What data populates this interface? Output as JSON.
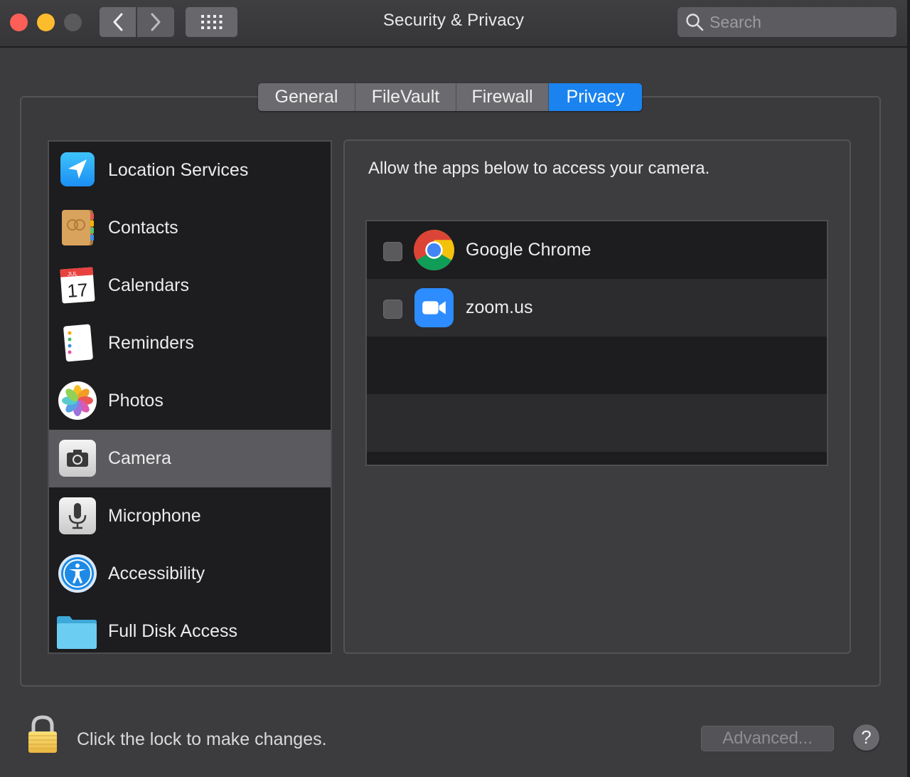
{
  "window": {
    "title": "Security & Privacy"
  },
  "toolbar": {
    "search_placeholder": "Search",
    "icons": [
      "close-button",
      "minimize-button",
      "zoom-button",
      "chevron-left-icon",
      "chevron-right-icon",
      "grid-icon",
      "search-icon"
    ]
  },
  "tabs": [
    {
      "label": "General",
      "selected": false
    },
    {
      "label": "FileVault",
      "selected": false
    },
    {
      "label": "Firewall",
      "selected": false
    },
    {
      "label": "Privacy",
      "selected": true
    }
  ],
  "categories": [
    {
      "label": "Location Services",
      "icon": "location-arrow-icon",
      "selected": false
    },
    {
      "label": "Contacts",
      "icon": "contacts-book-icon",
      "selected": false
    },
    {
      "label": "Calendars",
      "icon": "calendar-icon",
      "month": "JUL",
      "day": "17",
      "selected": false
    },
    {
      "label": "Reminders",
      "icon": "reminders-icon",
      "selected": false
    },
    {
      "label": "Photos",
      "icon": "photos-flower-icon",
      "selected": false
    },
    {
      "label": "Camera",
      "icon": "camera-icon",
      "selected": true
    },
    {
      "label": "Microphone",
      "icon": "microphone-icon",
      "selected": false
    },
    {
      "label": "Accessibility",
      "icon": "accessibility-icon",
      "selected": false
    },
    {
      "label": "Full Disk Access",
      "icon": "folder-icon",
      "selected": false
    }
  ],
  "pane": {
    "heading": "Allow the apps below to access your camera.",
    "apps": [
      {
        "name": "Google Chrome",
        "icon": "chrome-icon",
        "checked": false
      },
      {
        "name": "zoom.us",
        "icon": "zoom-icon",
        "checked": false
      }
    ]
  },
  "footer": {
    "lock_text": "Click the lock to make changes.",
    "advanced_label": "Advanced...",
    "help_label": "?"
  },
  "colors": {
    "accent": "#1a83f0",
    "window_bg": "#3c3b3e",
    "list_bg": "#1d1c1f",
    "selected_row": "#5b5a5e"
  }
}
